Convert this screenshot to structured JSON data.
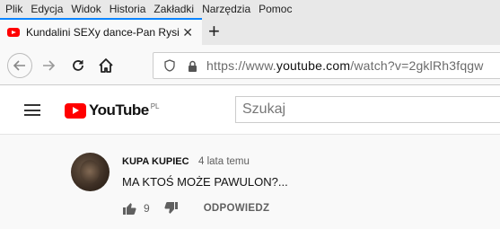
{
  "menu": [
    "Plik",
    "Edycja",
    "Widok",
    "Historia",
    "Zakładki",
    "Narzędzia",
    "Pomoc"
  ],
  "tab": {
    "title": "Kundalini SEXy dance-Pan Rysi",
    "close": "✕",
    "new_tab": "+"
  },
  "urlbar": {
    "prefix": "https://www.",
    "domain": "youtube.com",
    "suffix": "/watch?v=2gklRh3fqgw"
  },
  "youtube": {
    "logo_text": "YouTube",
    "country": "PL",
    "search_placeholder": "Szukaj"
  },
  "comment": {
    "author": "KUPA KUPIEC",
    "time": "4 lata temu",
    "text": "MA KTOŚ MOŻE PAWULON?...",
    "likes": "9",
    "reply_label": "ODPOWIEDZ"
  },
  "icons": [
    "back-icon",
    "forward-icon",
    "reload-icon",
    "home-icon",
    "shield-icon",
    "lock-icon",
    "menu-icon",
    "thumb-up-icon",
    "thumb-down-icon"
  ],
  "colors": {
    "accent": "#0a84ff",
    "youtube_red": "#ff0000"
  }
}
